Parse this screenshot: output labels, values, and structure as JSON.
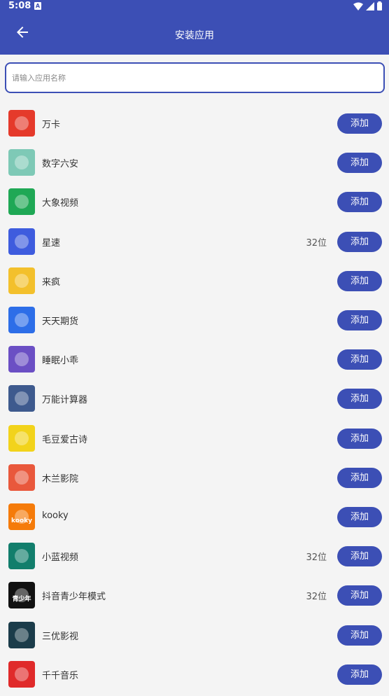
{
  "status": {
    "time": "5:08",
    "notif_letter": "A"
  },
  "appbar": {
    "title": "安装应用"
  },
  "search": {
    "placeholder": "请输入应用名称"
  },
  "add_label": "添加",
  "apps": [
    {
      "name": "万卡",
      "badge": "",
      "icon": "wanka-icon",
      "color": "#e53a2b"
    },
    {
      "name": "数字六安",
      "badge": "",
      "icon": "shuzi-luan-icon",
      "color": "#7ec9b6"
    },
    {
      "name": "大象视频",
      "badge": "",
      "icon": "elephant-icon",
      "color": "#1fa855"
    },
    {
      "name": "星速",
      "badge": "32位",
      "icon": "star-shield-icon",
      "color": "#3e5cde"
    },
    {
      "name": "来疯",
      "badge": "",
      "icon": "bee-icon",
      "color": "#f3c02c"
    },
    {
      "name": "天天期货",
      "badge": "",
      "icon": "diamond-icon",
      "color": "#2d6ee8"
    },
    {
      "name": "睡眠小乖",
      "badge": "",
      "icon": "moon-icon",
      "color": "#6b4fc4"
    },
    {
      "name": "万能计算器",
      "badge": "",
      "icon": "calculator-icon",
      "color": "#3e5a8e"
    },
    {
      "name": "毛豆爱古诗",
      "badge": "",
      "icon": "panda-icon",
      "color": "#f2d31b"
    },
    {
      "name": "木兰影院",
      "badge": "",
      "icon": "film-icon",
      "color": "#e9583c"
    },
    {
      "name": "kooky",
      "badge": "",
      "icon": "kooky-icon",
      "color": "#f57b0a",
      "logo": "kooky"
    },
    {
      "name": "小蓝视频",
      "badge": "32位",
      "icon": "android-icon",
      "color": "#127e6c"
    },
    {
      "name": "抖音青少年模式",
      "badge": "32位",
      "icon": "tiktok-icon",
      "color": "#111111",
      "logo": "青少年"
    },
    {
      "name": "三优影视",
      "badge": "",
      "icon": "play-icon",
      "color": "#1b3c4a"
    },
    {
      "name": "千千音乐",
      "badge": "",
      "icon": "qianqian-icon",
      "color": "#e02a2a"
    }
  ]
}
